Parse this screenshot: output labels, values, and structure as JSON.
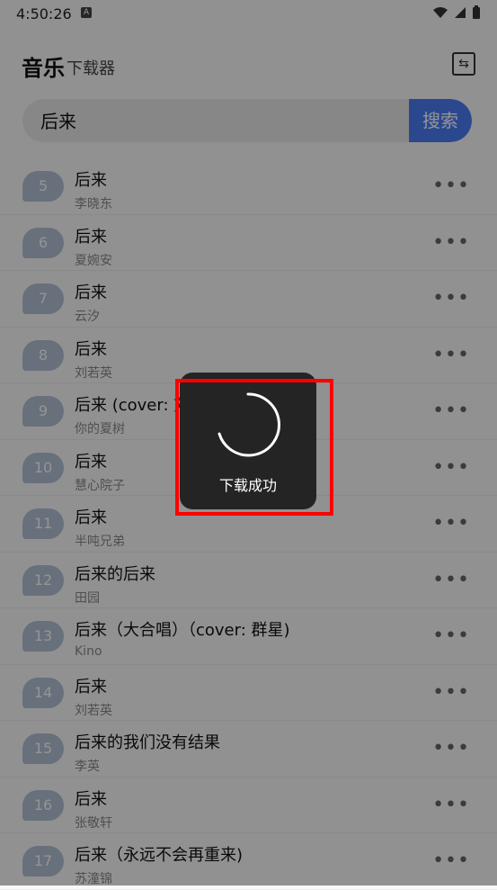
{
  "status": {
    "time": "4:50:26",
    "a_icon": "A"
  },
  "app": {
    "title": "音乐",
    "subtitle": "下载器"
  },
  "search": {
    "value": "后来",
    "button": "搜索"
  },
  "songs": [
    {
      "num": "5",
      "title": "后来",
      "artist": "李晓东"
    },
    {
      "num": "6",
      "title": "后来",
      "artist": "夏婉安"
    },
    {
      "num": "7",
      "title": "后来",
      "artist": "云汐"
    },
    {
      "num": "8",
      "title": "后来",
      "artist": "刘若英"
    },
    {
      "num": "9",
      "title": "后来 (cover: 刘",
      "artist": "你的夏树"
    },
    {
      "num": "10",
      "title": "后来",
      "artist": "慧心院子"
    },
    {
      "num": "11",
      "title": "后来",
      "artist": "半吨兄弟"
    },
    {
      "num": "12",
      "title": "后来的后来",
      "artist": "田园"
    },
    {
      "num": "13",
      "title": "后来（大合唱）（cover: 群星)",
      "artist": "Kino"
    },
    {
      "num": "14",
      "title": "后来",
      "artist": "刘若英"
    },
    {
      "num": "15",
      "title": "后来的我们没有结果",
      "artist": "李英"
    },
    {
      "num": "16",
      "title": "后来",
      "artist": "张敬轩"
    },
    {
      "num": "17",
      "title": "后来（永远不会再重来)",
      "artist": "苏潼锦"
    }
  ],
  "more_label": "•••",
  "toast": {
    "message": "下载成功"
  },
  "colors": {
    "accent": "#4a7cf7",
    "badge": "#b4c1d6",
    "highlight": "#ff0000"
  }
}
